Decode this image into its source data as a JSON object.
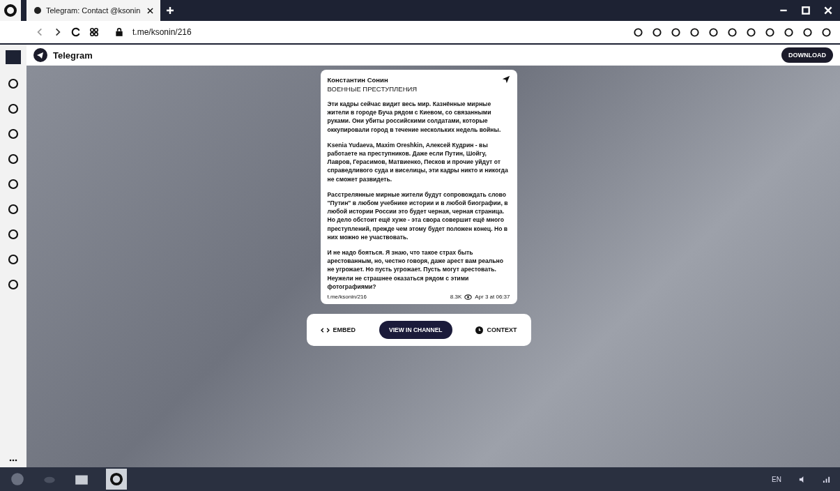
{
  "tabs": [
    {
      "title": "Telegram: Contact @ksonin",
      "selected": true
    }
  ],
  "address_bar": {
    "url": "t.me/ksonin/216"
  },
  "page_header": {
    "title": "Telegram",
    "button": "DOWNLOAD"
  },
  "post": {
    "author": "Константин Сонин",
    "heading": "ВОЕННЫЕ ПРЕСТУПЛЕНИЯ",
    "paragraphs": [
      "Эти кадры сейчас видит весь мир. Казнённые мирные жители в городе Буча рядом с Киевом, со связанными руками. Они убиты российскими солдатами, которые оккупировали город в течение нескольких недель войны.",
      "Ksenia Yudaeva, Maxim Oreshkin, Алексей Кудрин - вы работаете на преступников. Даже если Путин, Шойгу, Лавров, Герасимов, Матвиенко, Песков и прочие уйдут от справедливого суда и виселицы, эти кадры никто и никогда не сможет развидеть.",
      "Расстрелянные мирные жители будут сопровождать слово \"Путин\" в любом учебнике истории и в любой биографии, в любой истории России это будет черная, черная страница. Но дело обстоит ещё хуже - эта свора совершит ещё много преступлений, прежде чем этому будет положен конец. Но в них можно не участвовать.",
      "И не надо бояться. Я знаю, что такое страх быть арестованным, но, честно говоря, даже арест вам реально не угрожает. Но пусть угрожает. Пусть могут арестовать. Неужели не страшнее оказаться рядом с этими фотографиями?"
    ],
    "link": "t.me/ksonin/216",
    "views": "8.3K",
    "date": "Apr 3 at 06:37"
  },
  "actions": [
    {
      "label": "EMBED",
      "kind": "embed"
    },
    {
      "label": "VIEW IN CHANNEL",
      "kind": "primary"
    },
    {
      "label": "CONTEXT",
      "kind": "context"
    }
  ],
  "taskbar": {
    "language": "EN"
  }
}
